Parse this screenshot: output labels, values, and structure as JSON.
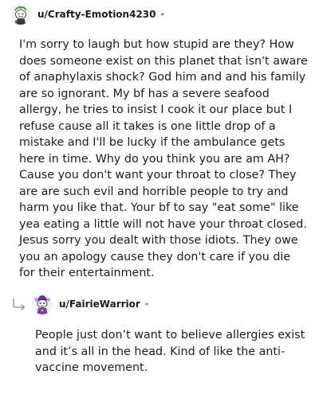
{
  "comments": [
    {
      "username": "u/Crafty-Emotion4230",
      "separator": "•",
      "avatar_icon": "snoo-avatar-green-hair-icon",
      "body": "I'm sorry to laugh but how stupid are they? How does someone exist on this planet that isn't aware of anaphylaxis shock? God him and and his family are so ignorant. My bf has a severe seafood allergy, he tries to insist I cook it our place but I refuse cause all it takes is one little drop of a mistake and I'll be lucky if the ambulance gets here in time. Why do you think you are am AH? Cause you don't want your throat to close? They are are such evil and horrible people to try and harm you like that. Your bf to say \"eat some\" like yea eating a little will not have your throat closed. Jesus sorry you dealt with those idiots. They owe you an apology cause they don't care if you die for their entertainment."
    },
    {
      "username": "u/FairieWarrior",
      "separator": "•",
      "avatar_icon": "snoo-avatar-purple-fairy-icon",
      "reply_icon": "reply-arrow-icon",
      "body": "People just don’t want to believe allergies exist and it’s all in the head. Kind of like the anti-vaccine movement."
    }
  ],
  "colors": {
    "text": "#1c1c1c",
    "meta": "#7c7c7c",
    "reply_arrow": "#a0a0a0"
  }
}
